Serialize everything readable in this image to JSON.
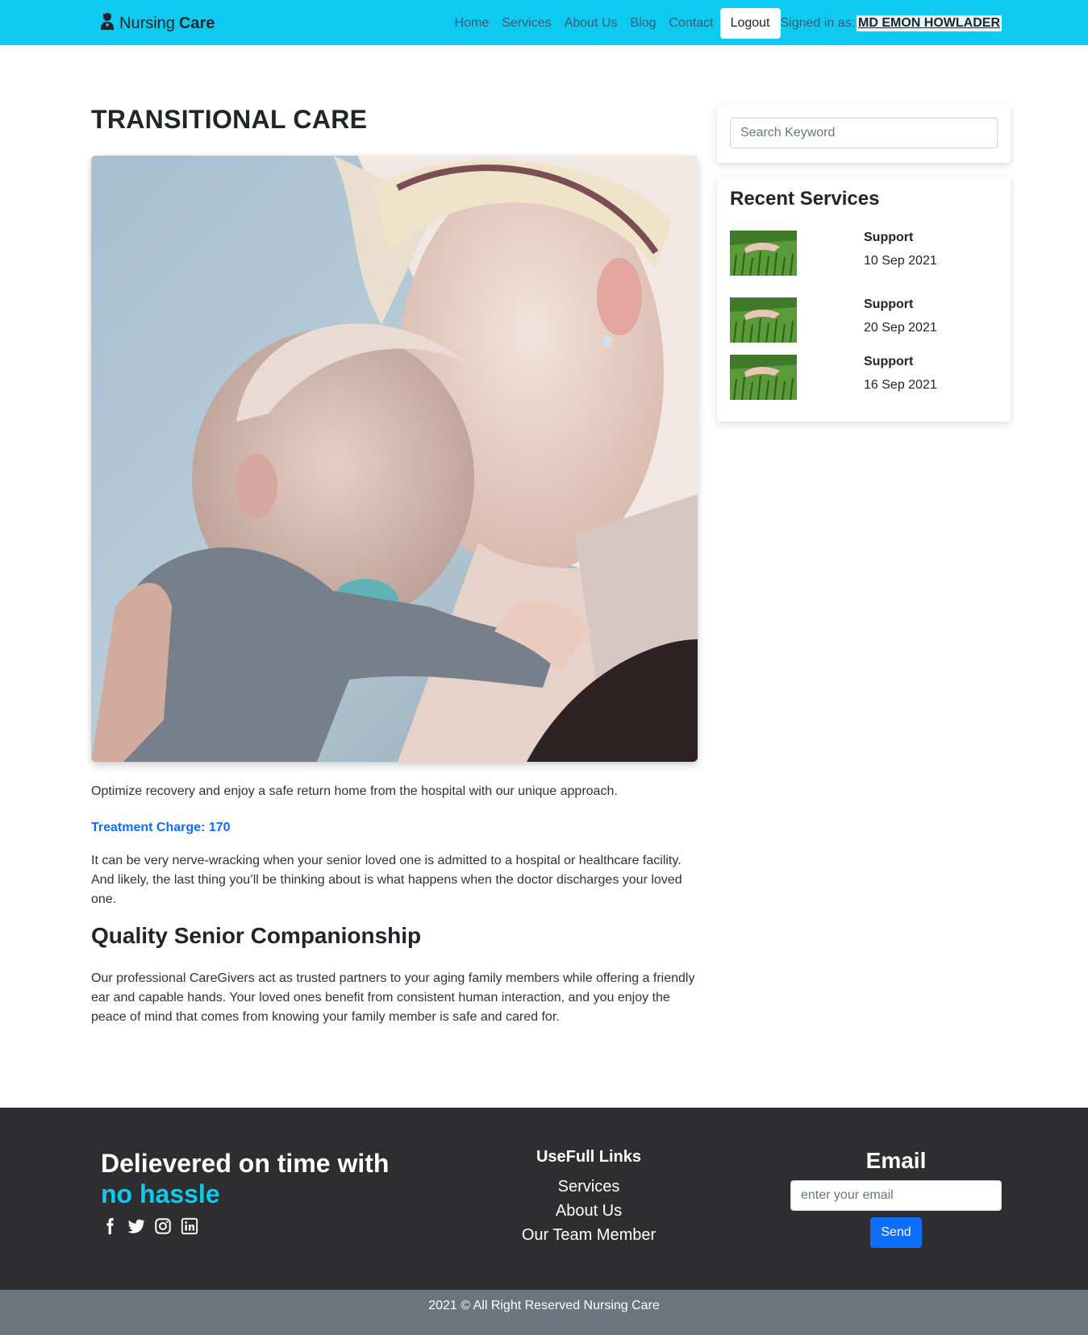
{
  "nav": {
    "brand_first": "Nursing",
    "brand_second": "Care",
    "links": [
      "Home",
      "Services",
      "About Us",
      "Blog",
      "Contact"
    ],
    "logout_label": "Logout",
    "signed_in_label": "Signed in as:",
    "user_name": "MD EMON HOWLADER",
    "bar_color": "#0dcaf0"
  },
  "main": {
    "title": "TRANSITIONAL CARE",
    "intro": "Optimize recovery and enjoy a safe return home from the hospital with our unique approach.",
    "charge_label": "Treatment Charge: 170",
    "paragraph1": "It can be very nerve-wracking when your senior loved one is admitted to a hospital or healthcare facility. And likely, the last thing you’ll be thinking about is what happens when the doctor discharges your loved one.",
    "section_title": "Quality Senior Companionship",
    "paragraph2": "Our professional CareGivers act as trusted partners to your aging family members while offering a friendly ear and capable hands. Your loved ones benefit from consistent human interaction, and you enjoy the peace of mind that comes from knowing your family member is safe and cared for."
  },
  "sidebar": {
    "search_placeholder": "Search Keyword",
    "recent_title": "Recent Services",
    "recent_items": [
      {
        "name": "Support",
        "date": "10 Sep 2021"
      },
      {
        "name": "Support",
        "date": "20 Sep 2021"
      },
      {
        "name": "Support",
        "date": "16 Sep 2021"
      }
    ]
  },
  "footer": {
    "tagline_line1": "Delievered on time with",
    "tagline_line2": "no hassle",
    "socials": [
      "facebook-icon",
      "twitter-icon",
      "instagram-icon",
      "linkedin-icon"
    ],
    "links_title": "UseFull Links",
    "links": [
      "Services",
      "About Us",
      "Our Team Member"
    ],
    "email_title": "Email",
    "email_placeholder": "enter your email",
    "send_label": "Send",
    "copyright": "2021 © All Right Reserved Nursing Care",
    "accent_color": "#0dcaf0"
  }
}
